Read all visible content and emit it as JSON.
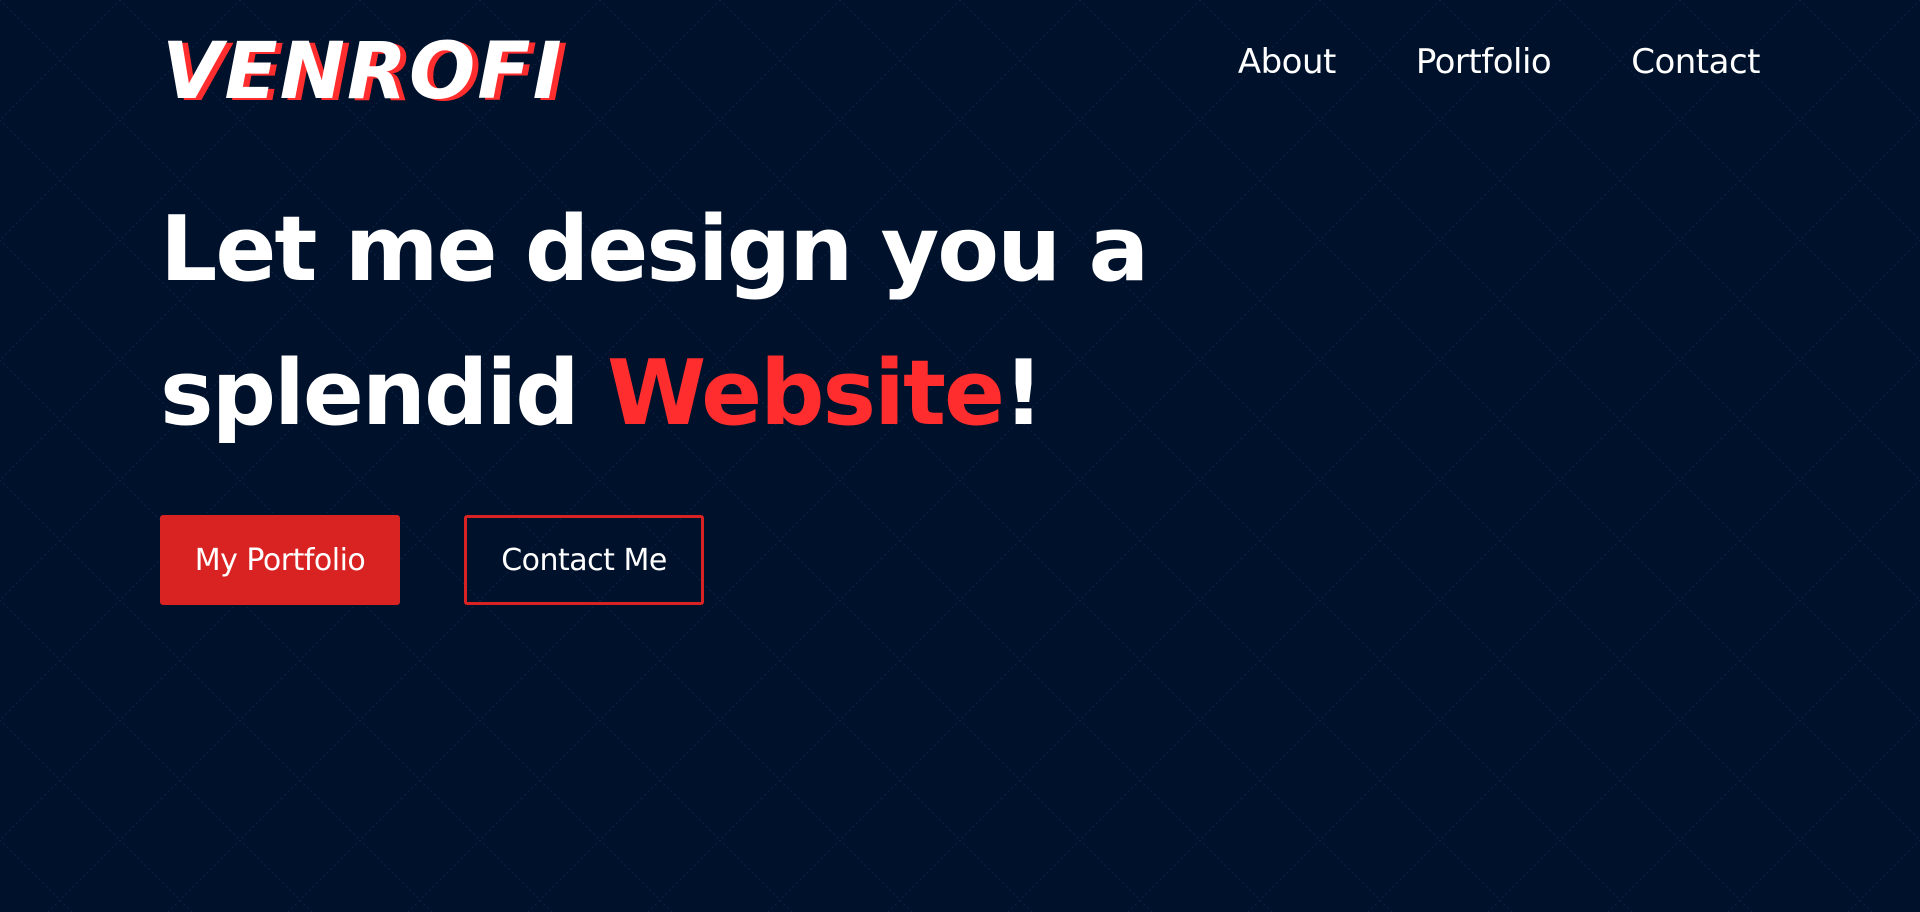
{
  "brand": {
    "logo_text": "VENROFI",
    "colors": {
      "background": "#00112b",
      "accent": "#ff2d2d",
      "button": "#d92323",
      "text": "#ffffff"
    }
  },
  "nav": {
    "items": [
      {
        "label": "About"
      },
      {
        "label": "Portfolio"
      },
      {
        "label": "Contact"
      }
    ]
  },
  "hero": {
    "line1": "Let me design you a",
    "line2_prefix": "splendid ",
    "line2_accent": "Website",
    "line2_suffix": "!"
  },
  "cta": {
    "primary_label": "My Portfolio",
    "secondary_label": "Contact Me"
  }
}
